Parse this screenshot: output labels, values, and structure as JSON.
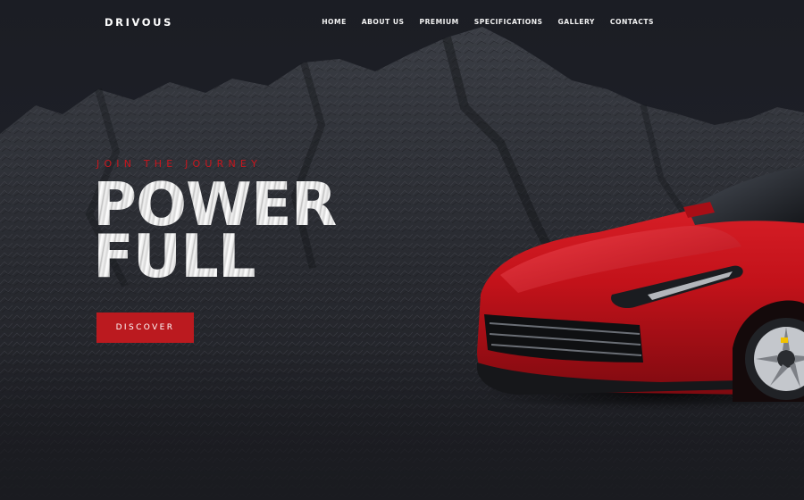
{
  "brand": {
    "logo_text": "DRIVOUS"
  },
  "nav": {
    "items": [
      {
        "label": "HOME"
      },
      {
        "label": "ABOUT US"
      },
      {
        "label": "PREMIUM"
      },
      {
        "label": "SPECIFICATIONS"
      },
      {
        "label": "GALLERY"
      },
      {
        "label": "CONTACTS"
      }
    ]
  },
  "hero": {
    "tagline": "JOIN THE JOURNEY",
    "headline_line1": "POWER",
    "headline_line2": "FULL",
    "cta_label": "DISCOVER"
  },
  "colors": {
    "accent": "#bb1a1f",
    "background": "#1c1e24",
    "car_body": "#c8141c"
  },
  "icons": {
    "background_image": "mountain-photo",
    "hero_image": "red-sports-car"
  }
}
